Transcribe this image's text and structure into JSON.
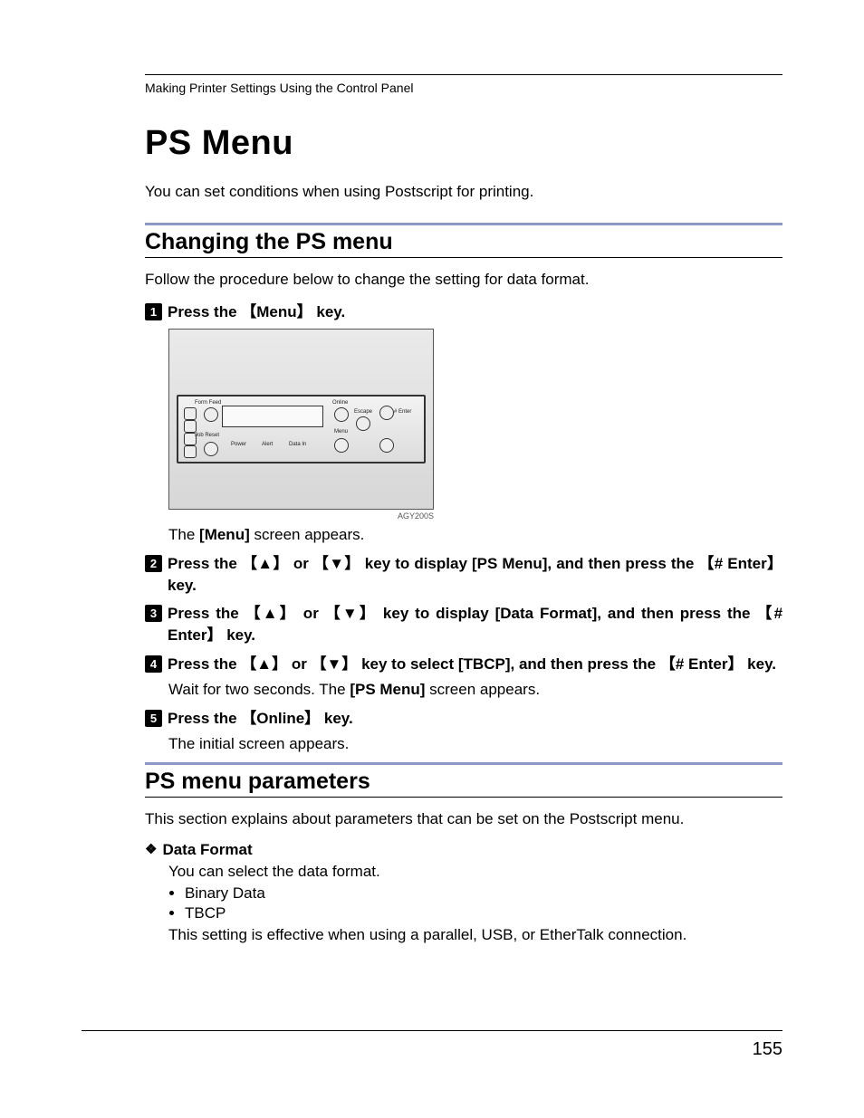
{
  "running_head": "Making Printer Settings Using the Control Panel",
  "title": "PS Menu",
  "intro": "You can set conditions when using Postscript for printing.",
  "section1": {
    "heading": "Changing the PS menu",
    "lead": "Follow the procedure below to change the setting for data format.",
    "steps": {
      "s1_a": "Press the ",
      "s1_key": "Menu",
      "s1_b": " key.",
      "s1_sub_a": "The ",
      "s1_sub_key": "[Menu]",
      "s1_sub_b": " screen appears.",
      "s2_a": "Press the ",
      "s2_or": " or ",
      "s2_b": " key to display ",
      "s2_item": "[PS Menu]",
      "s2_c": ", and then press the ",
      "s2_key": "# Enter",
      "s2_d": " key.",
      "s3_a": "Press the ",
      "s3_or": " or ",
      "s3_b": " key to display ",
      "s3_item": "[Data Format]",
      "s3_c": ", and then press the ",
      "s3_key": "# Enter",
      "s3_d": " key.",
      "s4_a": "Press the ",
      "s4_or": " or ",
      "s4_b": " key to select ",
      "s4_item": "[TBCP]",
      "s4_c": ", and then press the ",
      "s4_key": "# Enter",
      "s4_d": " key.",
      "s4_sub_a": "Wait for two seconds. The ",
      "s4_sub_key": "[PS Menu]",
      "s4_sub_b": " screen appears.",
      "s5_a": "Press the ",
      "s5_key": "Online",
      "s5_b": " key.",
      "s5_sub": "The initial screen appears."
    },
    "figure": {
      "labels": {
        "form_feed": "Form Feed",
        "job_reset": "Job Reset",
        "power": "Power",
        "alert": "Alert",
        "data_in": "Data In",
        "online": "Online",
        "escape": "Escape",
        "menu": "Menu",
        "enter": "# Enter"
      },
      "code": "AGY200S"
    }
  },
  "section2": {
    "heading": "PS menu parameters",
    "lead": "This section explains about parameters that can be set on the Postscript menu.",
    "param_title": "Data Format",
    "param_desc": "You can select the data format.",
    "options": [
      "Binary Data",
      "TBCP"
    ],
    "param_note": "This setting is effective when using a parallel, USB, or EtherTalk connection."
  },
  "glyphs": {
    "up": "▲",
    "down": "▼",
    "lbr": "【",
    "rbr": "】",
    "diamond": "❖"
  },
  "page_number": "155"
}
